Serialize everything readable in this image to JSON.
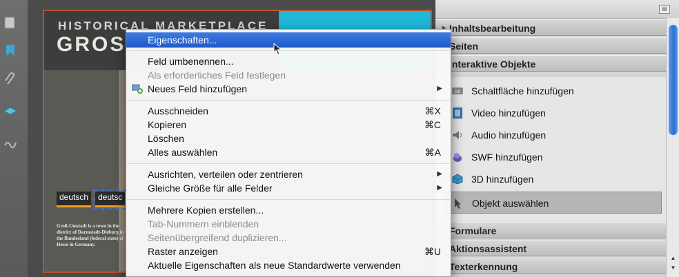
{
  "document": {
    "header_line1": "HISTORICAL MARKETPLACE",
    "header_line2": "GROSS",
    "buttons": [
      "deutsch",
      "deutsc"
    ],
    "blurb": "Groß-Umstadt is a town in the district of Darmstadt-Dieburg in the Bundesland (federal state) of Hesse in Germany."
  },
  "context_menu": {
    "items": [
      {
        "label": "Eigenschaften...",
        "shortcut": "",
        "submenu": false,
        "disabled": false,
        "highlighted": true
      },
      {
        "label": "Feld umbenennen...",
        "shortcut": "",
        "submenu": false,
        "disabled": false
      },
      {
        "label": "Als erforderliches Feld festlegen",
        "shortcut": "",
        "submenu": false,
        "disabled": true
      },
      {
        "label": "Neues Feld hinzufügen",
        "shortcut": "",
        "submenu": true,
        "disabled": false,
        "icon": "add-field-icon"
      },
      {
        "label": "Ausschneiden",
        "shortcut": "⌘X",
        "submenu": false,
        "disabled": false
      },
      {
        "label": "Kopieren",
        "shortcut": "⌘C",
        "submenu": false,
        "disabled": false
      },
      {
        "label": "Löschen",
        "shortcut": "",
        "submenu": false,
        "disabled": false
      },
      {
        "label": "Alles auswählen",
        "shortcut": "⌘A",
        "submenu": false,
        "disabled": false
      },
      {
        "label": "Ausrichten, verteilen oder zentrieren",
        "shortcut": "",
        "submenu": true,
        "disabled": false
      },
      {
        "label": "Gleiche Größe für alle Felder",
        "shortcut": "",
        "submenu": true,
        "disabled": false
      },
      {
        "label": "Mehrere Kopien erstellen...",
        "shortcut": "",
        "submenu": false,
        "disabled": false
      },
      {
        "label": "Tab-Nummern einblenden",
        "shortcut": "",
        "submenu": false,
        "disabled": true
      },
      {
        "label": "Seitenübergreifend duplizieren...",
        "shortcut": "",
        "submenu": false,
        "disabled": true
      },
      {
        "label": "Raster anzeigen",
        "shortcut": "⌘U",
        "submenu": false,
        "disabled": false
      },
      {
        "label": "Aktuelle Eigenschaften als neue Standardwerte verwenden",
        "shortcut": "",
        "submenu": false,
        "disabled": false
      }
    ]
  },
  "panel": {
    "sections": {
      "content_editing": "Inhaltsbearbeitung",
      "pages": "Seiten",
      "interactive": "Interaktive Objekte",
      "forms": "Formulare",
      "action_wizard": "Aktionsassistent",
      "text_recognition": "Texterkennung"
    },
    "items": [
      {
        "label": "Schaltfläche hinzufügen",
        "icon": "button-ok-icon"
      },
      {
        "label": "Video hinzufügen",
        "icon": "film-icon"
      },
      {
        "label": "Audio hinzufügen",
        "icon": "speaker-icon"
      },
      {
        "label": "SWF hinzufügen",
        "icon": "swf-icon"
      },
      {
        "label": "3D hinzufügen",
        "icon": "cube-icon"
      },
      {
        "label": "Objekt auswählen",
        "icon": "select-arrow-icon",
        "active": true
      }
    ]
  },
  "colors": {
    "menu_highlight": "#2a66d4",
    "page_border": "#b7532c",
    "cyan_block": "#1fb8d8"
  }
}
